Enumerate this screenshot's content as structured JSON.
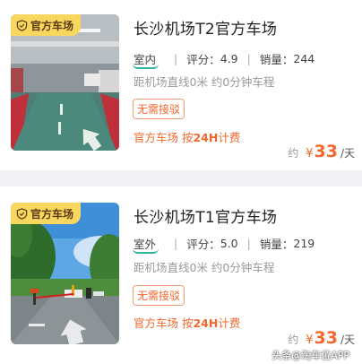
{
  "listings": [
    {
      "badge": "官方车场",
      "title": "长沙机场T2官方车场",
      "parking_type": "室内",
      "rating_label": "评分：",
      "rating": "4.9",
      "sales_label": "销量：",
      "sales": "244",
      "distance_text": "距机场直线0米  约0分钟车程",
      "tag": "无需接驳",
      "billing_prefix": "官方车场 按",
      "billing_highlight": "24H",
      "billing_suffix": "计费",
      "price_prefix": "约",
      "currency": "¥",
      "price": "33",
      "price_unit": "/天"
    },
    {
      "badge": "官方车场",
      "title": "长沙机场T1官方车场",
      "parking_type": "室外",
      "rating_label": "评分：",
      "rating": "5.0",
      "sales_label": "销量：",
      "sales": "219",
      "distance_text": "距机场直线0米  约0分钟车程",
      "tag": "无需接驳",
      "billing_prefix": "官方车场 按",
      "billing_highlight": "24H",
      "billing_suffix": "计费",
      "price_prefix": "约",
      "currency": "¥",
      "price": "33",
      "price_unit": "/天"
    }
  ],
  "watermark": "头条@淘车位APP",
  "icons": {
    "badge": "shield-icon"
  },
  "colors": {
    "accent": "#f0682c",
    "badge_bg": "#f8d75f",
    "underline": "#2bb5a0"
  }
}
